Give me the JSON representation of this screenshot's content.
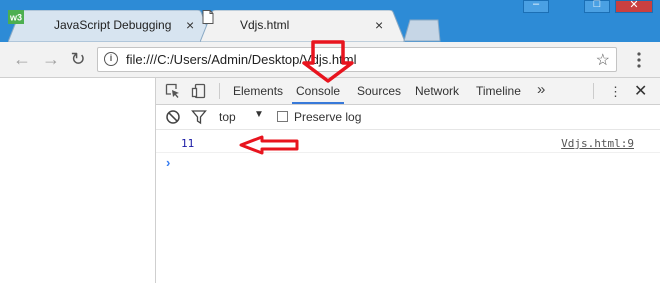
{
  "tabs": [
    {
      "title": "JavaScript Debugging",
      "active": false,
      "icon": "w3-schools-icon"
    },
    {
      "title": "Vdjs.html",
      "active": true,
      "icon": "document-icon"
    }
  ],
  "tab_close_glyph": "×",
  "window_controls": {
    "minimize": "–",
    "restore": "□",
    "close": "✕"
  },
  "nav": {
    "back": "←",
    "forward": "→",
    "reload": "↻"
  },
  "address_bar": {
    "url": "file:///C:/Users/Admin/Desktop/Vdjs.html",
    "star": "☆"
  },
  "devtools": {
    "tabs": [
      "Elements",
      "Console",
      "Sources",
      "Network",
      "Timeline"
    ],
    "active_tab": "Console",
    "more": "»",
    "kebab": "⋮",
    "close": "✕",
    "console_toolbar": {
      "context": "top",
      "context_arrow": "▼",
      "preserve_log_label": "Preserve log",
      "preserve_log_checked": false
    },
    "log_entries": [
      {
        "value": "11",
        "source": "Vdjs.html:9"
      }
    ],
    "prompt": "›"
  },
  "colors": {
    "titlebar": "#2d8bd6",
    "annotation": "#e8141e",
    "tab_active": "#f2f2f2",
    "tab_inactive": "#d7e4f0",
    "active_underline": "#3879d9"
  }
}
